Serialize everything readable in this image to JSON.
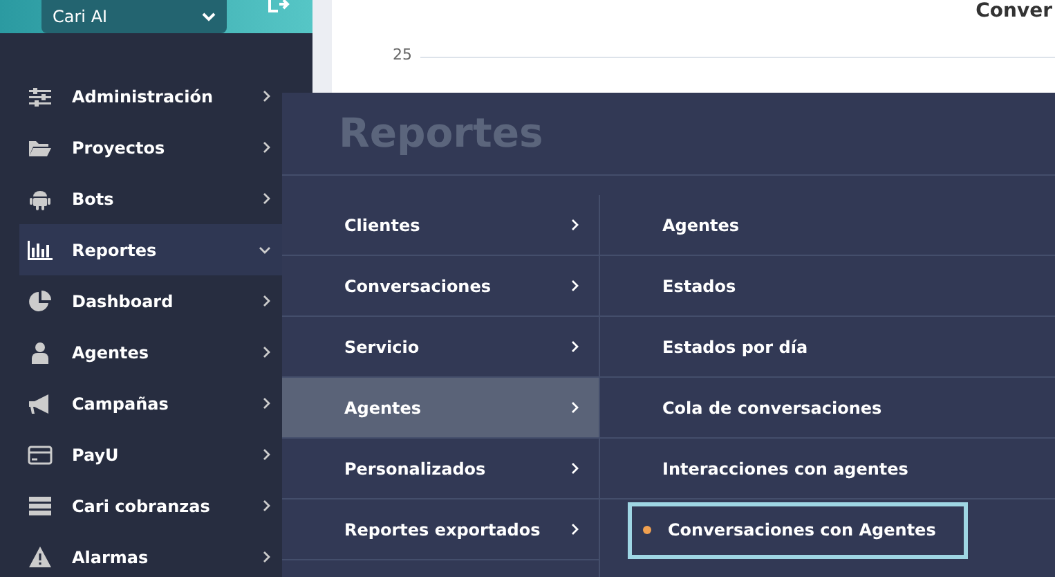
{
  "header": {
    "account_select": "Cari AI"
  },
  "sidebar": {
    "items": [
      {
        "label": "Administración",
        "kind": "sliders",
        "expanded": false,
        "selected": false
      },
      {
        "label": "Proyectos",
        "kind": "folder",
        "expanded": false,
        "selected": false
      },
      {
        "label": "Bots",
        "kind": "android",
        "expanded": false,
        "selected": false
      },
      {
        "label": "Reportes",
        "kind": "chart",
        "expanded": true,
        "selected": true
      },
      {
        "label": "Dashboard",
        "kind": "pie",
        "expanded": false,
        "selected": false
      },
      {
        "label": "Agentes",
        "kind": "user",
        "expanded": false,
        "selected": false
      },
      {
        "label": "Campañas",
        "kind": "megaphone",
        "expanded": false,
        "selected": false
      },
      {
        "label": "PayU",
        "kind": "card",
        "expanded": false,
        "selected": false
      },
      {
        "label": "Cari cobranzas",
        "kind": "server",
        "expanded": false,
        "selected": false
      },
      {
        "label": "Alarmas",
        "kind": "warning",
        "expanded": false,
        "selected": false
      }
    ]
  },
  "main": {
    "title": "Conver",
    "y_tick": "25"
  },
  "flyout": {
    "title": "Reportes",
    "categories": [
      {
        "label": "Clientes",
        "selected": false
      },
      {
        "label": "Conversaciones",
        "selected": false
      },
      {
        "label": "Servicio",
        "selected": false
      },
      {
        "label": "Agentes",
        "selected": true
      },
      {
        "label": "Personalizados",
        "selected": false
      },
      {
        "label": "Reportes exportados",
        "selected": false
      }
    ],
    "reports": [
      {
        "label": "Agentes",
        "selected": false
      },
      {
        "label": "Estados",
        "selected": false
      },
      {
        "label": "Estados por día",
        "selected": false
      },
      {
        "label": "Cola de conversaciones",
        "selected": false
      },
      {
        "label": "Interacciones con agentes",
        "selected": false
      },
      {
        "label": "Conversaciones con Agentes",
        "selected": true
      }
    ]
  }
}
